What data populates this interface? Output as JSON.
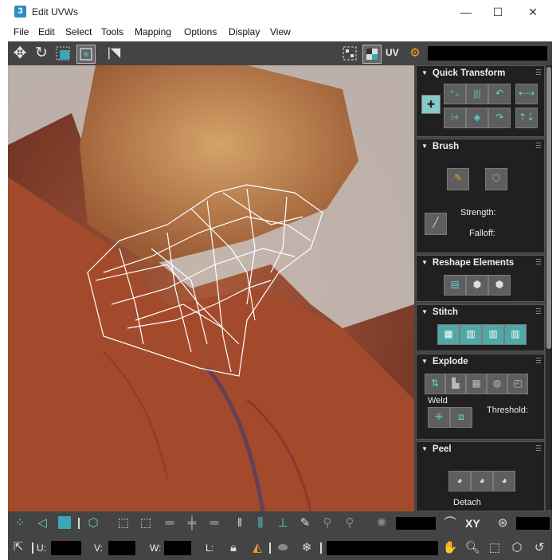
{
  "window": {
    "title": "Edit UVWs",
    "app_badge": "3",
    "minimize": "—",
    "maximize": "☐",
    "close": "✕"
  },
  "menu": [
    "File",
    "Edit",
    "Select",
    "Tools",
    "Mapping",
    "Options",
    "Display",
    "View"
  ],
  "top_toolbar": {
    "uv_label": "UV"
  },
  "panel": {
    "quick_transform": {
      "title": "Quick Transform"
    },
    "brush": {
      "title": "Brush",
      "strength_label": "Strength:",
      "falloff_label": "Falloff:"
    },
    "reshape": {
      "title": "Reshape Elements"
    },
    "stitch": {
      "title": "Stitch"
    },
    "explode": {
      "title": "Explode",
      "weld_label": "Weld",
      "threshold_label": "Threshold:"
    },
    "peel": {
      "title": "Peel",
      "detach_label": "Detach"
    }
  },
  "bottom_toolbar": {
    "xy_label": "XY"
  },
  "status_bar": {
    "u_label": "U:",
    "v_label": "V:",
    "w_label": "W:",
    "l_label": "L:"
  },
  "icons": {
    "move": "move-icon",
    "rotate": "rotate-icon",
    "scale": "scale-icon",
    "freeform": "freeform-icon",
    "mirror": "mirror-icon",
    "checker": "checker-icon",
    "uv_options": "uv-options-icon",
    "settings": "gear-icon",
    "hand": "pan-icon",
    "zoom": "zoom-icon",
    "lock": "lock-icon",
    "snowflake": "freeze-icon"
  }
}
